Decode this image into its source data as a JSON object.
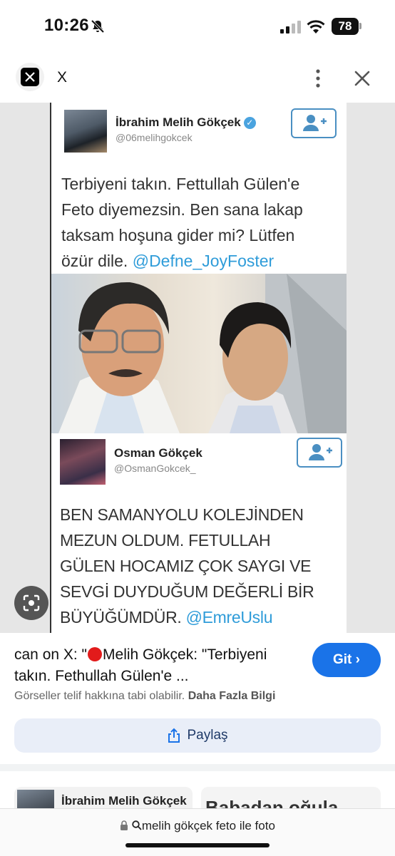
{
  "status_bar": {
    "time": "10:26",
    "battery": "78"
  },
  "tab": {
    "site": "X"
  },
  "image": {
    "tweet1": {
      "name": "İbrahim Melih Gökçek",
      "handle": "@06melihgokcek",
      "text": "Terbiyeni takın. Fettullah Gülen'e\nFeto diyemezsin. Ben sana lakap\ntaksam hoşuna gider mi? Lütfen\nözür dile.",
      "mention": "@Defne_JoyFoster"
    },
    "tweet2": {
      "name": "Osman Gökçek",
      "handle": "@OsmanGokcek_",
      "text": "BEN SAMANYOLU KOLEJİNDEN\nMEZUN OLDUM. FETULLAH\nGÜLEN HOCAMIZ ÇOK SAYGI VE\nSEVGİ  DUYDUĞUM DEĞERLİ BİR\nBÜYÜĞÜMDÜR.",
      "mention": "@EmreUslu"
    }
  },
  "result": {
    "title_prefix": "can on X: \"",
    "title_rest": "Melih Gökçek: \"Terbiyeni takın. Fethullah Gülen'e ...",
    "go_label": "Git",
    "copyright_text": "Görseller telif hakkına tabi olabilir.",
    "copyright_link": "Daha Fazla Bilgi",
    "share_label": "Paylaş"
  },
  "related": {
    "thumb1_name": "İbrahim Melih Gökçek",
    "thumb2_text": "Babadan oğula"
  },
  "address_bar": {
    "query": "melih gökçek feto ile foto"
  }
}
